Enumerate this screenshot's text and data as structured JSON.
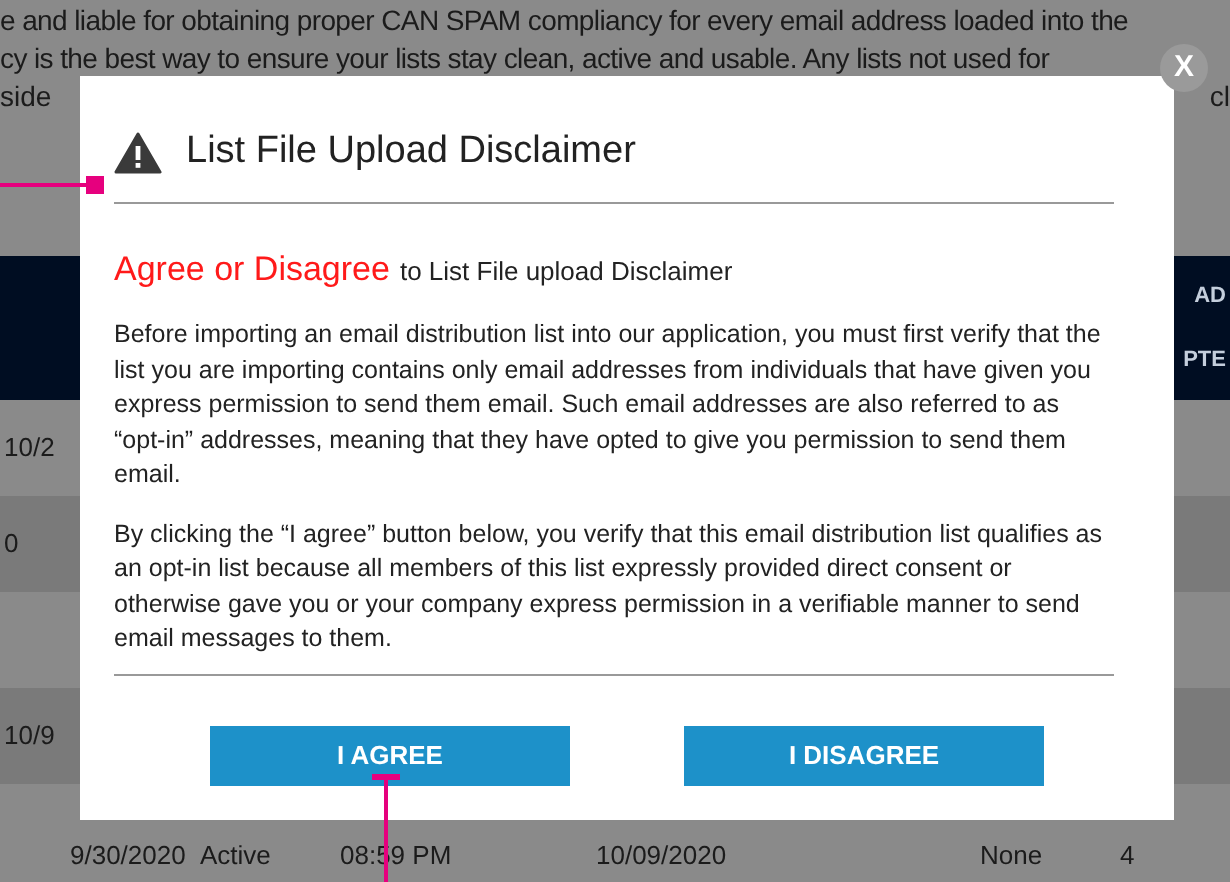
{
  "background": {
    "notice_lines": [
      "e and liable for obtaining proper CAN SPAM compliancy for every email address loaded into the",
      "cy is the best way to ensure your lists stay clean, active and usable. Any lists not used for"
    ],
    "notice_fragments": [
      "side",
      "cl"
    ],
    "table": {
      "header_fragments": [
        "AD",
        "PTE"
      ],
      "rows": [
        {
          "text": "10/2"
        },
        {
          "text": "0"
        },
        {},
        {
          "text": "10/9"
        }
      ],
      "last_row": [
        "9/30/2020",
        "Active",
        "08:59 PM",
        "10/09/2020",
        "None",
        "4"
      ]
    }
  },
  "close_label": "X",
  "dialog": {
    "title": "List File Upload Disclaimer",
    "lead_highlight": "Agree or Disagree",
    "lead_rest": "to List File upload Disclaimer",
    "paragraphs": [
      "Before importing an email distribution list into our application, you must first verify that the list you are importing contains only email addresses from individuals that have given you express permission to send them email. Such email addresses are also referred to as “opt-in” addresses, meaning that they have opted to give you permission to send them email.",
      "By clicking the “I agree” button below, you verify that this email distribution list qualifies as an opt-in list because all members of this list expressly provided direct consent or otherwise gave you or your company express permission in a verifiable manner to send email messages to them."
    ],
    "buttons": [
      "I AGREE",
      "I DISAGREE"
    ]
  }
}
